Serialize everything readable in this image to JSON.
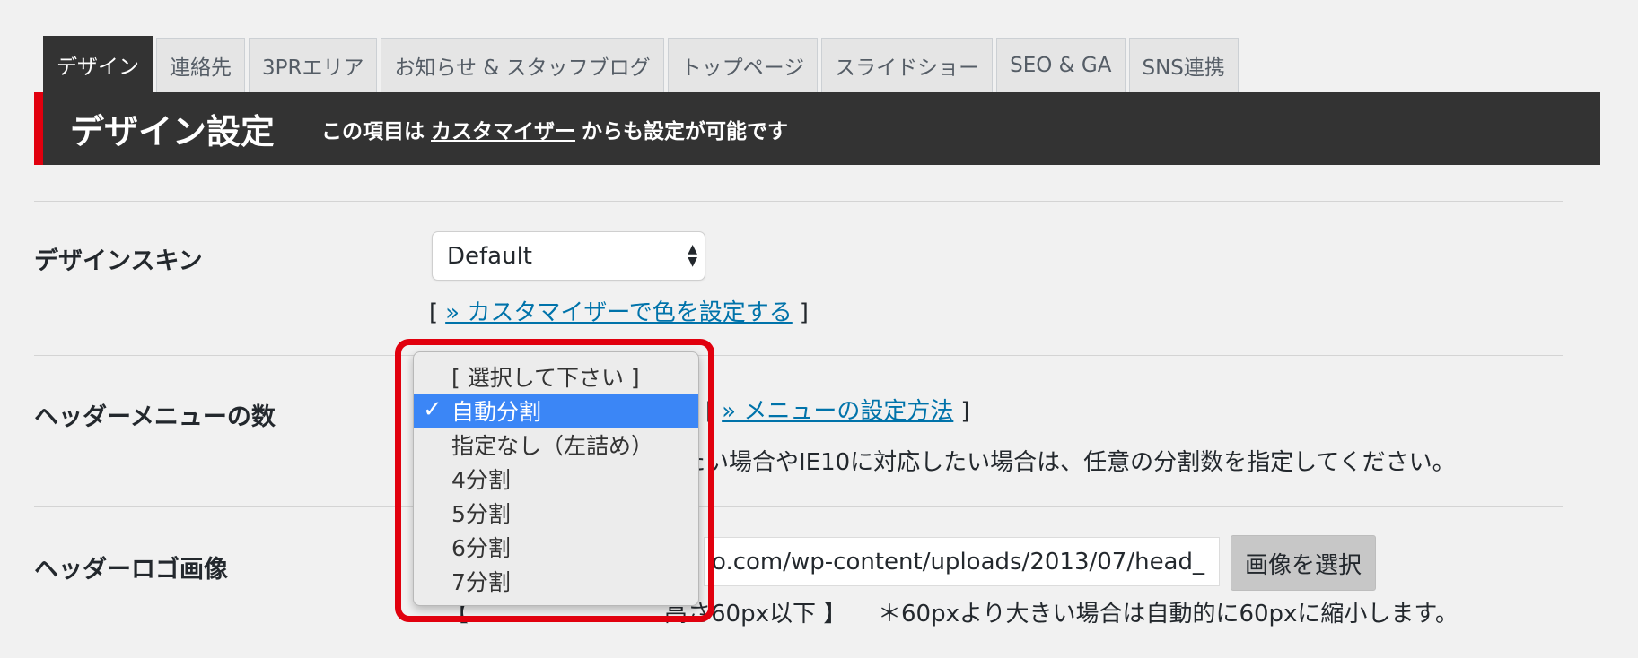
{
  "tabs": [
    {
      "label": "デザイン"
    },
    {
      "label": "連絡先"
    },
    {
      "label": "3PRエリア"
    },
    {
      "label": "お知らせ & スタッフブログ"
    },
    {
      "label": "トップページ"
    },
    {
      "label": "スライドショー"
    },
    {
      "label": "SEO & GA"
    },
    {
      "label": "SNS連携"
    }
  ],
  "banner": {
    "title": "デザイン設定",
    "note_before": "この項目は",
    "note_link": "カスタマイザー",
    "note_after": "からも設定が可能です"
  },
  "design_skin": {
    "label": "デザインスキン",
    "selected": "Default",
    "link_text": "» カスタマイザーで色を設定する"
  },
  "header_menu": {
    "label": "ヘッダーメニューの数",
    "link_text": "» メニューの設定方法",
    "description_visible": "たい場合やIE10に対応したい場合は、任意の分割数を指定してください。"
  },
  "header_logo": {
    "label": "ヘッダーロゴ画像",
    "url_value": "o.com/wp-content/uploads/2013/07/head_",
    "button_label": "画像を選択",
    "note_bracket_open": "【",
    "note_tail": "高さ60px以下 】",
    "note_right": "＊60pxより大きい場合は自動的に60pxに縮小します。"
  },
  "brackets": {
    "open": "[",
    "close": "]"
  },
  "dropdown": {
    "options": [
      {
        "label": "[ 選択して下さい ]"
      },
      {
        "label": "自動分割"
      },
      {
        "label": "指定なし（左詰め）"
      },
      {
        "label": "4分割"
      },
      {
        "label": "5分割"
      },
      {
        "label": "6分割"
      },
      {
        "label": "7分割"
      }
    ],
    "selected_index": 1,
    "check_mark": "✓"
  },
  "colors": {
    "accent_red": "#e1000e",
    "banner_bg": "#333333",
    "link_blue": "#0073aa",
    "selected_option_bg": "#3b86f6"
  }
}
